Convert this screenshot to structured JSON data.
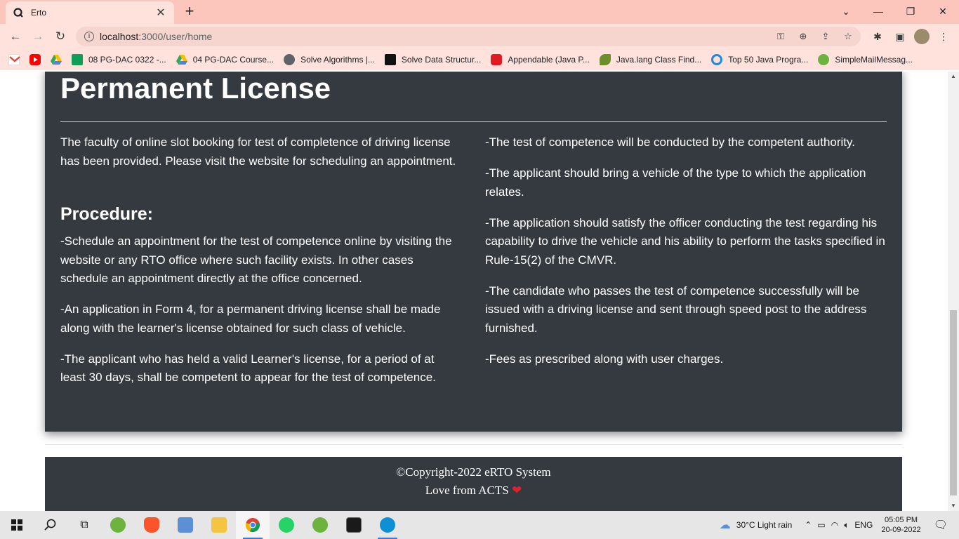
{
  "browser": {
    "tab_title": "Erto",
    "tab_close": "✕",
    "new_tab": "+",
    "url_host": "localhost",
    "url_rest": ":3000/user/home",
    "window_controls": {
      "minimize": "—",
      "restore": "❐",
      "close": "✕"
    },
    "bookmarks": [
      {
        "label": "08 PG-DAC 0322 -...",
        "icon": "sheets-icon",
        "color": "#0f9d58"
      },
      {
        "label": "04 PG-DAC Course...",
        "icon": "drive-icon",
        "color": "#fbbc04"
      },
      {
        "label": "Solve Algorithms |...",
        "icon": "globe-icon",
        "color": "#5f6368"
      },
      {
        "label": "Solve Data Structur...",
        "icon": "hackerrank-icon",
        "color": "#111111"
      },
      {
        "label": "Appendable (Java P...",
        "icon": "oracle-icon",
        "color": "#e11b22"
      },
      {
        "label": "Java.lang Class Find...",
        "icon": "bird-icon",
        "color": "#6a8f2b"
      },
      {
        "label": "Top 50 Java Progra...",
        "icon": "refresh-icon",
        "color": "#1e88e5"
      },
      {
        "label": "SimpleMailMessag...",
        "icon": "spring-icon",
        "color": "#6db33f"
      }
    ]
  },
  "card": {
    "title": "Permanent License",
    "intro": "The faculty of online slot booking for test of completence of driving license has been provided. Please visit the website for scheduling an appointment.",
    "procedure_heading": "Procedure:",
    "left_steps": [
      "-Schedule an appointment for the test of competence online by visiting the website or any RTO office where such facility exists. In other cases schedule an appointment directly at the office concerned.",
      "-An application in Form 4, for a permanent driving license shall be made along with the learner's license obtained for such class of vehicle.",
      "-The applicant who has held a valid Learner's license, for a period of at least 30 days, shall be competent to appear for the test of competence."
    ],
    "right_steps": [
      "-The test of competence will be conducted by the competent authority.",
      "-The applicant should bring a vehicle of the type to which the application relates.",
      "-The application should satisfy the officer conducting the test regarding his capability to drive the vehicle and his ability to perform the tasks specified in Rule-15(2) of the CMVR.",
      "-The candidate who passes the test of competence successfully will be issued with a driving license and sent through speed post to the address furnished.",
      "-Fees as prescribed along with user charges."
    ]
  },
  "footer": {
    "copyright": "©Copyright-2022 eRTO System",
    "love": "Love from ACTS",
    "heart": "❤"
  },
  "taskbar": {
    "weather": "30°C  Light rain",
    "language": "ENG",
    "time": "05:05 PM",
    "date": "20-09-2022"
  }
}
